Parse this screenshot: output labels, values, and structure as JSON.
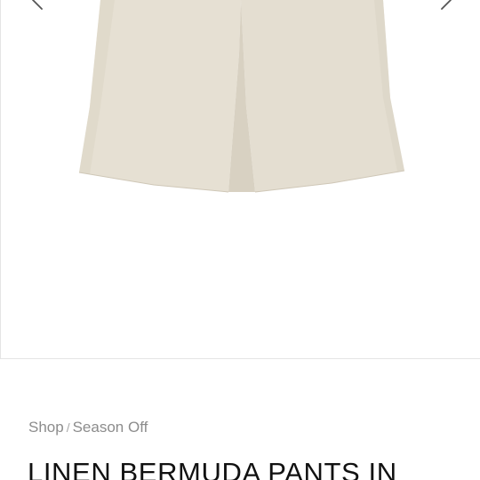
{
  "gallery": {
    "prev_icon": "chevron-left-icon",
    "next_icon": "chevron-right-icon",
    "image_color": "#e6e0d3",
    "image_shade": "#d9d2c4"
  },
  "breadcrumb": {
    "items": [
      "Shop",
      "Season Off"
    ],
    "separator": "/"
  },
  "product": {
    "title": "LINEN BERMUDA PANTS IN"
  }
}
